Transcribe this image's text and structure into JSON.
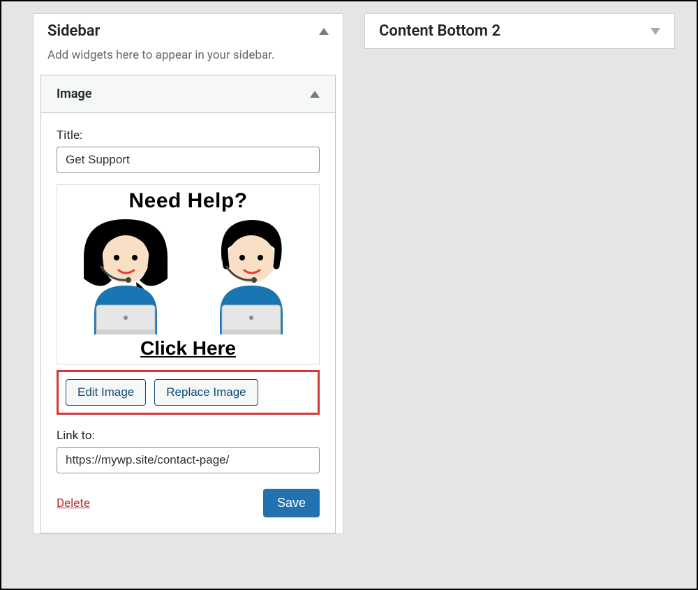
{
  "sidebar_panel": {
    "title": "Sidebar",
    "description": "Add widgets here to appear in your sidebar."
  },
  "content_bottom_panel": {
    "title": "Content Bottom 2"
  },
  "widget": {
    "title": "Image",
    "title_field_label": "Title:",
    "title_field_value": "Get Support",
    "image_text_top": "Need Help?",
    "image_text_bottom": "Click Here",
    "edit_button": "Edit Image",
    "replace_button": "Replace Image",
    "link_label": "Link to:",
    "link_value": "https://mywp.site/contact-page/",
    "delete": "Delete",
    "save": "Save"
  }
}
